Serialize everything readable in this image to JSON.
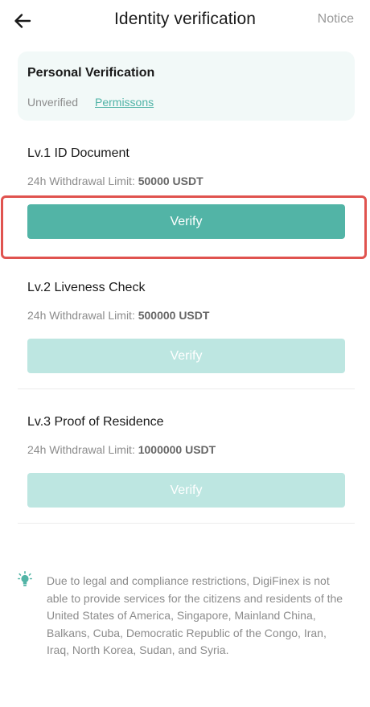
{
  "header": {
    "title": "Identity verification",
    "notice_label": "Notice"
  },
  "personal_verification": {
    "title": "Personal Verification",
    "status": "Unverified",
    "permissions_label": "Permissons"
  },
  "levels": [
    {
      "title": "Lv.1 ID Document",
      "limit_label": "24h Withdrawal Limit:",
      "limit_value": "50000 USDT",
      "button_label": "Verify",
      "button_state": "active"
    },
    {
      "title": "Lv.2 Liveness Check",
      "limit_label": "24h Withdrawal Limit:",
      "limit_value": "500000 USDT",
      "button_label": "Verify",
      "button_state": "disabled"
    },
    {
      "title": "Lv.3 Proof of Residence",
      "limit_label": "24h Withdrawal Limit:",
      "limit_value": "1000000 USDT",
      "button_label": "Verify",
      "button_state": "disabled"
    }
  ],
  "disclaimer": {
    "icon": "lightbulb-icon",
    "text": "Due to legal and compliance restrictions, DigiFinex is not able to provide services for the citizens and residents of the United States of America, Singapore, Mainland China, Balkans, Cuba, Democratic Republic of the Congo, Iran, Iraq, North Korea, Sudan, and Syria."
  },
  "colors": {
    "accent": "#52b4a6",
    "accent_disabled": "#bde6e1",
    "card_bg": "#f2f9f8",
    "highlight": "#e0534f"
  }
}
